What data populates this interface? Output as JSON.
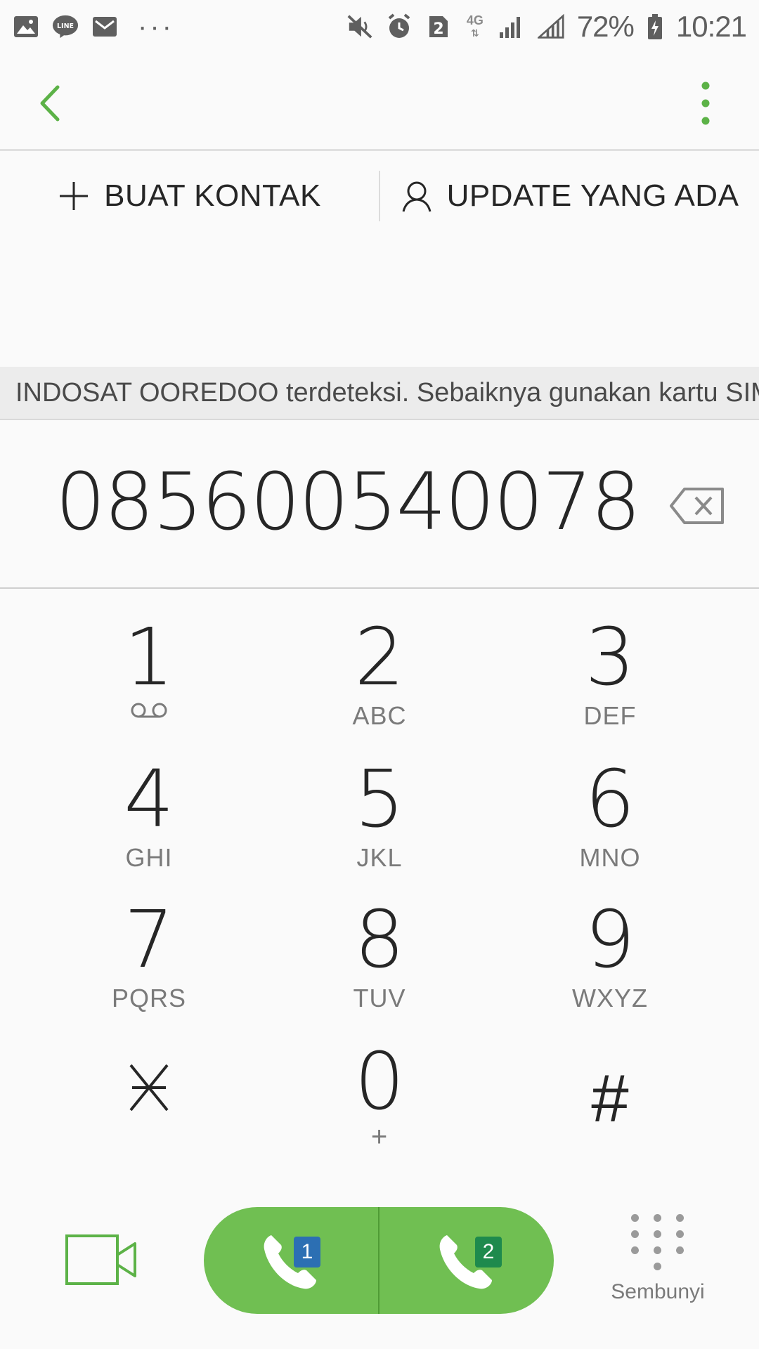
{
  "status_bar": {
    "battery": "72%",
    "time": "10:21",
    "sim_slot": "2",
    "network": "4G",
    "icons": [
      "gallery-icon",
      "line-icon",
      "mail-icon",
      "more-notifications-icon",
      "mute-icon",
      "alarm-icon",
      "sim-icon",
      "signal-icon",
      "signal-icon",
      "battery-icon"
    ]
  },
  "app_bar": {
    "back_icon": "chevron-left-icon",
    "more_icon": "more-vert-icon"
  },
  "actions": {
    "create_contact": "BUAT KONTAK",
    "update_existing": "UPDATE YANG ADA"
  },
  "banner": {
    "text": "INDOSAT OOREDOO terdeteksi. Sebaiknya gunakan kartu SIM"
  },
  "dialer": {
    "number": "085600540078"
  },
  "keypad": [
    {
      "digit": "1",
      "letters": ""
    },
    {
      "digit": "2",
      "letters": "ABC"
    },
    {
      "digit": "3",
      "letters": "DEF"
    },
    {
      "digit": "4",
      "letters": "GHI"
    },
    {
      "digit": "5",
      "letters": "JKL"
    },
    {
      "digit": "6",
      "letters": "MNO"
    },
    {
      "digit": "7",
      "letters": "PQRS"
    },
    {
      "digit": "8",
      "letters": "TUV"
    },
    {
      "digit": "9",
      "letters": "WXYZ"
    },
    {
      "digit": "*",
      "letters": ""
    },
    {
      "digit": "0",
      "letters": "+"
    },
    {
      "digit": "#",
      "letters": ""
    }
  ],
  "bottom": {
    "sim1": "1",
    "sim2": "2",
    "hide_label": "Sembunyi"
  },
  "colors": {
    "accent": "#5cb247",
    "call_green": "#70bf52",
    "sim1_blue": "#2c6fb3",
    "sim2_green": "#1e8a4d"
  }
}
